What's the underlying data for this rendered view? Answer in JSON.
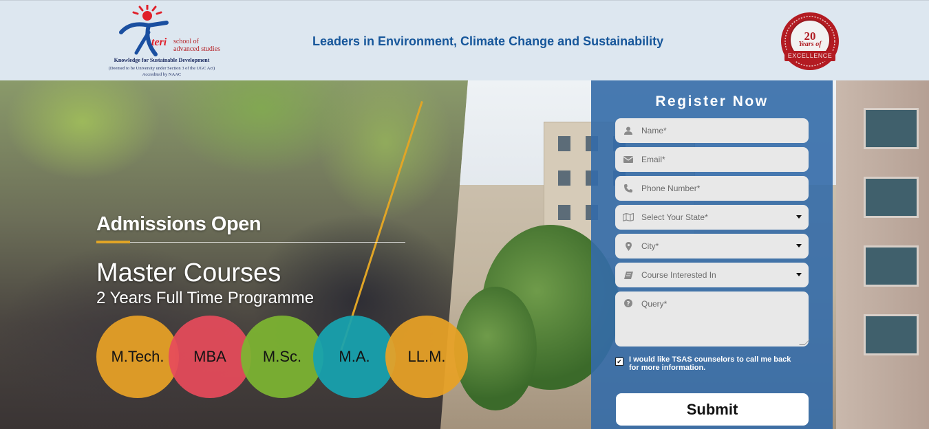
{
  "header": {
    "logo": {
      "brand": "teri",
      "school": "school of advanced studies",
      "tagline": "Knowledge for Sustainable Development",
      "deemed": "(Deemed to be University under Section 3 of the UGC Act)",
      "accreditation": "Accredited by NAAC"
    },
    "tagline": "Leaders in Environment, Climate Change and Sustainability",
    "badge": {
      "number": "20",
      "text": "Years of",
      "ribbon": "EXCELLENCE"
    }
  },
  "hero": {
    "admissions": "Admissions Open",
    "title": "Master Courses",
    "subtitle": "2 Years Full Time Programme",
    "courses": [
      {
        "label": "M.Tech.",
        "color": "#e8a226"
      },
      {
        "label": "MBA",
        "color": "#e64b5b"
      },
      {
        "label": "M.Sc.",
        "color": "#7db532"
      },
      {
        "label": "M.A.",
        "color": "#17a3b0"
      },
      {
        "label": "LL.M.",
        "color": "#e8a226"
      }
    ]
  },
  "form": {
    "title": "Register Now",
    "fields": {
      "name": {
        "placeholder": "Name*",
        "icon": "user-icon"
      },
      "email": {
        "placeholder": "Email*",
        "icon": "envelope-icon"
      },
      "phone": {
        "placeholder": "Phone Number*",
        "icon": "phone-icon"
      },
      "state": {
        "placeholder": "Select Your State*",
        "icon": "map-icon"
      },
      "city": {
        "placeholder": "City*",
        "icon": "map-marker-icon"
      },
      "course": {
        "placeholder": "Course Interested In",
        "icon": "book-icon"
      },
      "query": {
        "placeholder": "Query*",
        "icon": "question-circle-icon"
      }
    },
    "consent": {
      "checked": true,
      "label": "I would like TSAS counselors to call me back for more information."
    },
    "submit": "Submit"
  },
  "colors": {
    "header_bg": "#dde7f0",
    "tagline": "#16569a",
    "form_bg": "#346ca8",
    "accent": "#e1a526"
  }
}
